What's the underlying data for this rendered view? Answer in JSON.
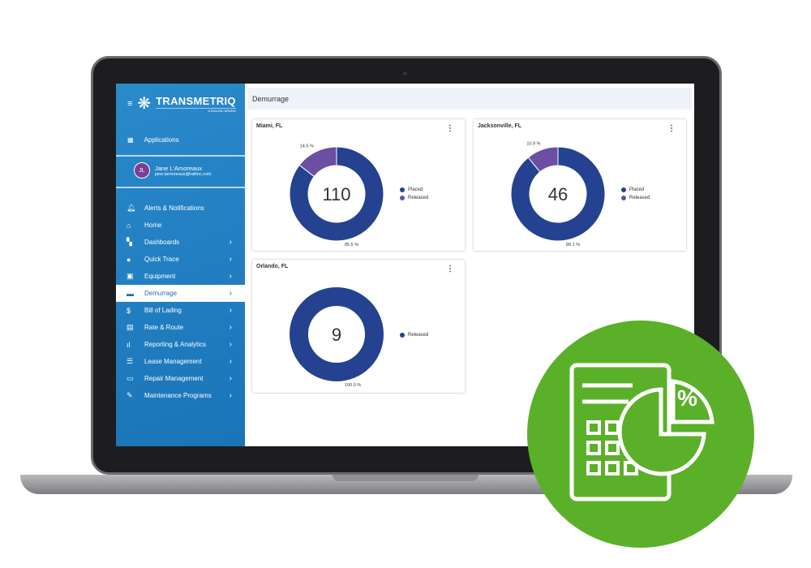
{
  "sidebar": {
    "brand": "TRANSMETRIQ",
    "brand_sub": "A RAILINC BRAND",
    "applications": "Applications",
    "user": {
      "initials": "JL",
      "name": "Jane L'Amoreaux",
      "email": "jane.lamoreaux@railinc.com"
    },
    "items": [
      {
        "label": "Alerts & Notifications",
        "icon": "bell-icon",
        "chevron": false
      },
      {
        "label": "Home",
        "icon": "home-icon",
        "chevron": false
      },
      {
        "label": "Dashboards",
        "icon": "dashboard-icon",
        "chevron": true
      },
      {
        "label": "Quick Trace",
        "icon": "map-pin-icon",
        "chevron": true
      },
      {
        "label": "Equipment",
        "icon": "train-icon",
        "chevron": true
      },
      {
        "label": "Demurrage",
        "icon": "railcar-icon",
        "chevron": true,
        "active": true
      },
      {
        "label": "Bill of Lading",
        "icon": "dollar-icon",
        "chevron": true
      },
      {
        "label": "Rate & Route",
        "icon": "money-icon",
        "chevron": true
      },
      {
        "label": "Reporting & Analytics",
        "icon": "bar-chart-icon",
        "chevron": true
      },
      {
        "label": "Lease Management",
        "icon": "list-icon",
        "chevron": true
      },
      {
        "label": "Repair Management",
        "icon": "shop-icon",
        "chevron": true
      },
      {
        "label": "Maintenance Programs",
        "icon": "wrench-icon",
        "chevron": true
      }
    ]
  },
  "header": {
    "title": "Demurrage"
  },
  "colors": {
    "placed": "#24428f",
    "released": "#6a4fa3",
    "badge": "#5bb02a"
  },
  "chart_data": [
    {
      "type": "pie",
      "title": "Miami, FL",
      "total": "110",
      "series": [
        {
          "name": "Placed",
          "value": 85.5,
          "label": "85.5 %"
        },
        {
          "name": "Released",
          "value": 14.5,
          "label": "14.5 %"
        }
      ]
    },
    {
      "type": "pie",
      "title": "Jacksonville, FL",
      "total": "46",
      "series": [
        {
          "name": "Placed",
          "value": 89.1,
          "label": "89.1 %"
        },
        {
          "name": "Released",
          "value": 10.9,
          "label": "10.9 %"
        }
      ]
    },
    {
      "type": "pie",
      "title": "Orlando, FL",
      "total": "9",
      "series": [
        {
          "name": "Released",
          "value": 100.0,
          "label": "100.0 %"
        }
      ]
    }
  ]
}
